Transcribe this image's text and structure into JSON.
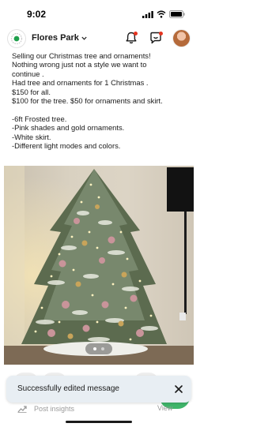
{
  "status_bar": {
    "time": "9:02"
  },
  "header": {
    "neighborhood": "Flores Park",
    "chevron": "chevron-down-icon"
  },
  "post": {
    "paragraph1": [
      "Selling our Christmas tree and ornaments!",
      "Nothing wrong just not a style we want to",
      "continue .",
      "Had tree and ornaments for 1 Christmas .",
      "$150 for all.",
      "$100 for the tree. $50 for ornaments and skirt."
    ],
    "paragraph2": [
      "-6ft Frosted tree.",
      "-Pink shades and gold ornaments.",
      "-White skirt.",
      "-Different light modes and colors."
    ]
  },
  "carousel": {
    "total": 2,
    "active": 1
  },
  "toast": {
    "message": "Successfully edited message"
  },
  "footer": {
    "insights_label": "Post insights",
    "view_label": "View"
  },
  "colors": {
    "badge": "#e5341f",
    "brand_green": "#3fb56a",
    "toast_bg": "#e8eef3"
  }
}
